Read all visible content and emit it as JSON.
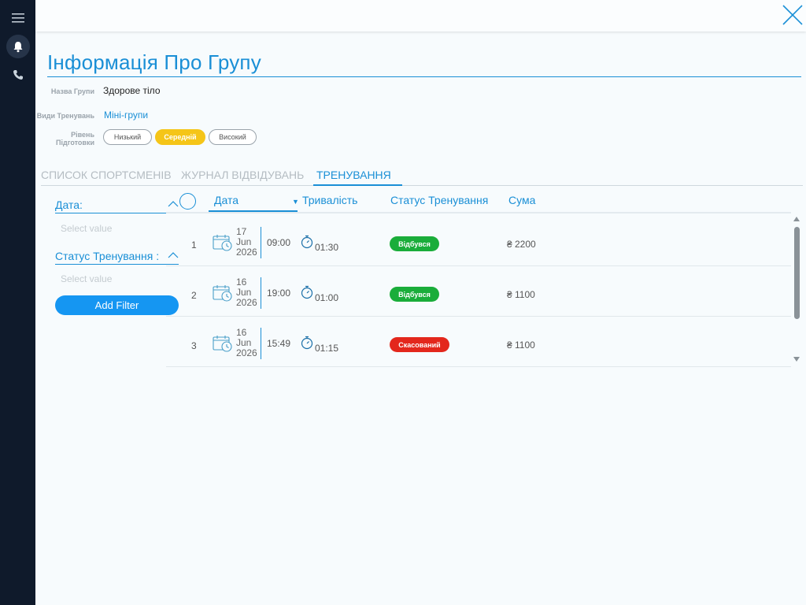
{
  "sidebar": {
    "icons": [
      "menu-icon",
      "bell-icon",
      "phone-icon"
    ]
  },
  "page": {
    "title": "Інформація Про Групу"
  },
  "info": {
    "group_name_label": "Назва Групи",
    "group_name_value": "Здорове тіло",
    "training_type_label": "Види Тренувань",
    "training_type_value": "Міні-групи",
    "level_label_1": "Рівень",
    "level_label_2": "Підготовки",
    "levels": [
      "Низький",
      "Середній",
      "Високий"
    ],
    "active_level": "Середній"
  },
  "tabs": [
    "СПИСОК СПОРТСМЕНІВ",
    "ЖУРНАЛ ВІДВІДУВАНЬ",
    "ТРЕНУВАННЯ"
  ],
  "active_tab": "ТРЕНУВАННЯ",
  "filters": {
    "date_label": "Дата:",
    "date_placeholder": "Select value",
    "status_label": "Статус Тренування :",
    "status_placeholder": "Select value",
    "add_filter_label": "Add Filter"
  },
  "table": {
    "columns": [
      "Дата",
      "Тривалість",
      "Статус Тренування",
      "Сума"
    ],
    "rows": [
      {
        "num": "1",
        "day": "17",
        "month": "Jun",
        "year": "2026",
        "time": "09:00",
        "duration": "01:30",
        "status": "Відбувся",
        "sum": "₴ 2200"
      },
      {
        "num": "2",
        "day": "16",
        "month": "Jun",
        "year": "2026",
        "time": "19:00",
        "duration": "01:00",
        "status": "Відбувся",
        "sum": "₴ 1100"
      },
      {
        "num": "3",
        "day": "16",
        "month": "Jun",
        "year": "2026",
        "time": "15:49",
        "duration": "01:15",
        "status": "Скасований",
        "sum": "₴ 1100"
      }
    ]
  },
  "colors": {
    "accent": "#1a8fd6",
    "sidebar_bg": "#0f1a2b",
    "status_done": "#1aad3a",
    "status_cancelled": "#e3271c",
    "level_active": "#f5c518",
    "button": "#1596f2"
  }
}
